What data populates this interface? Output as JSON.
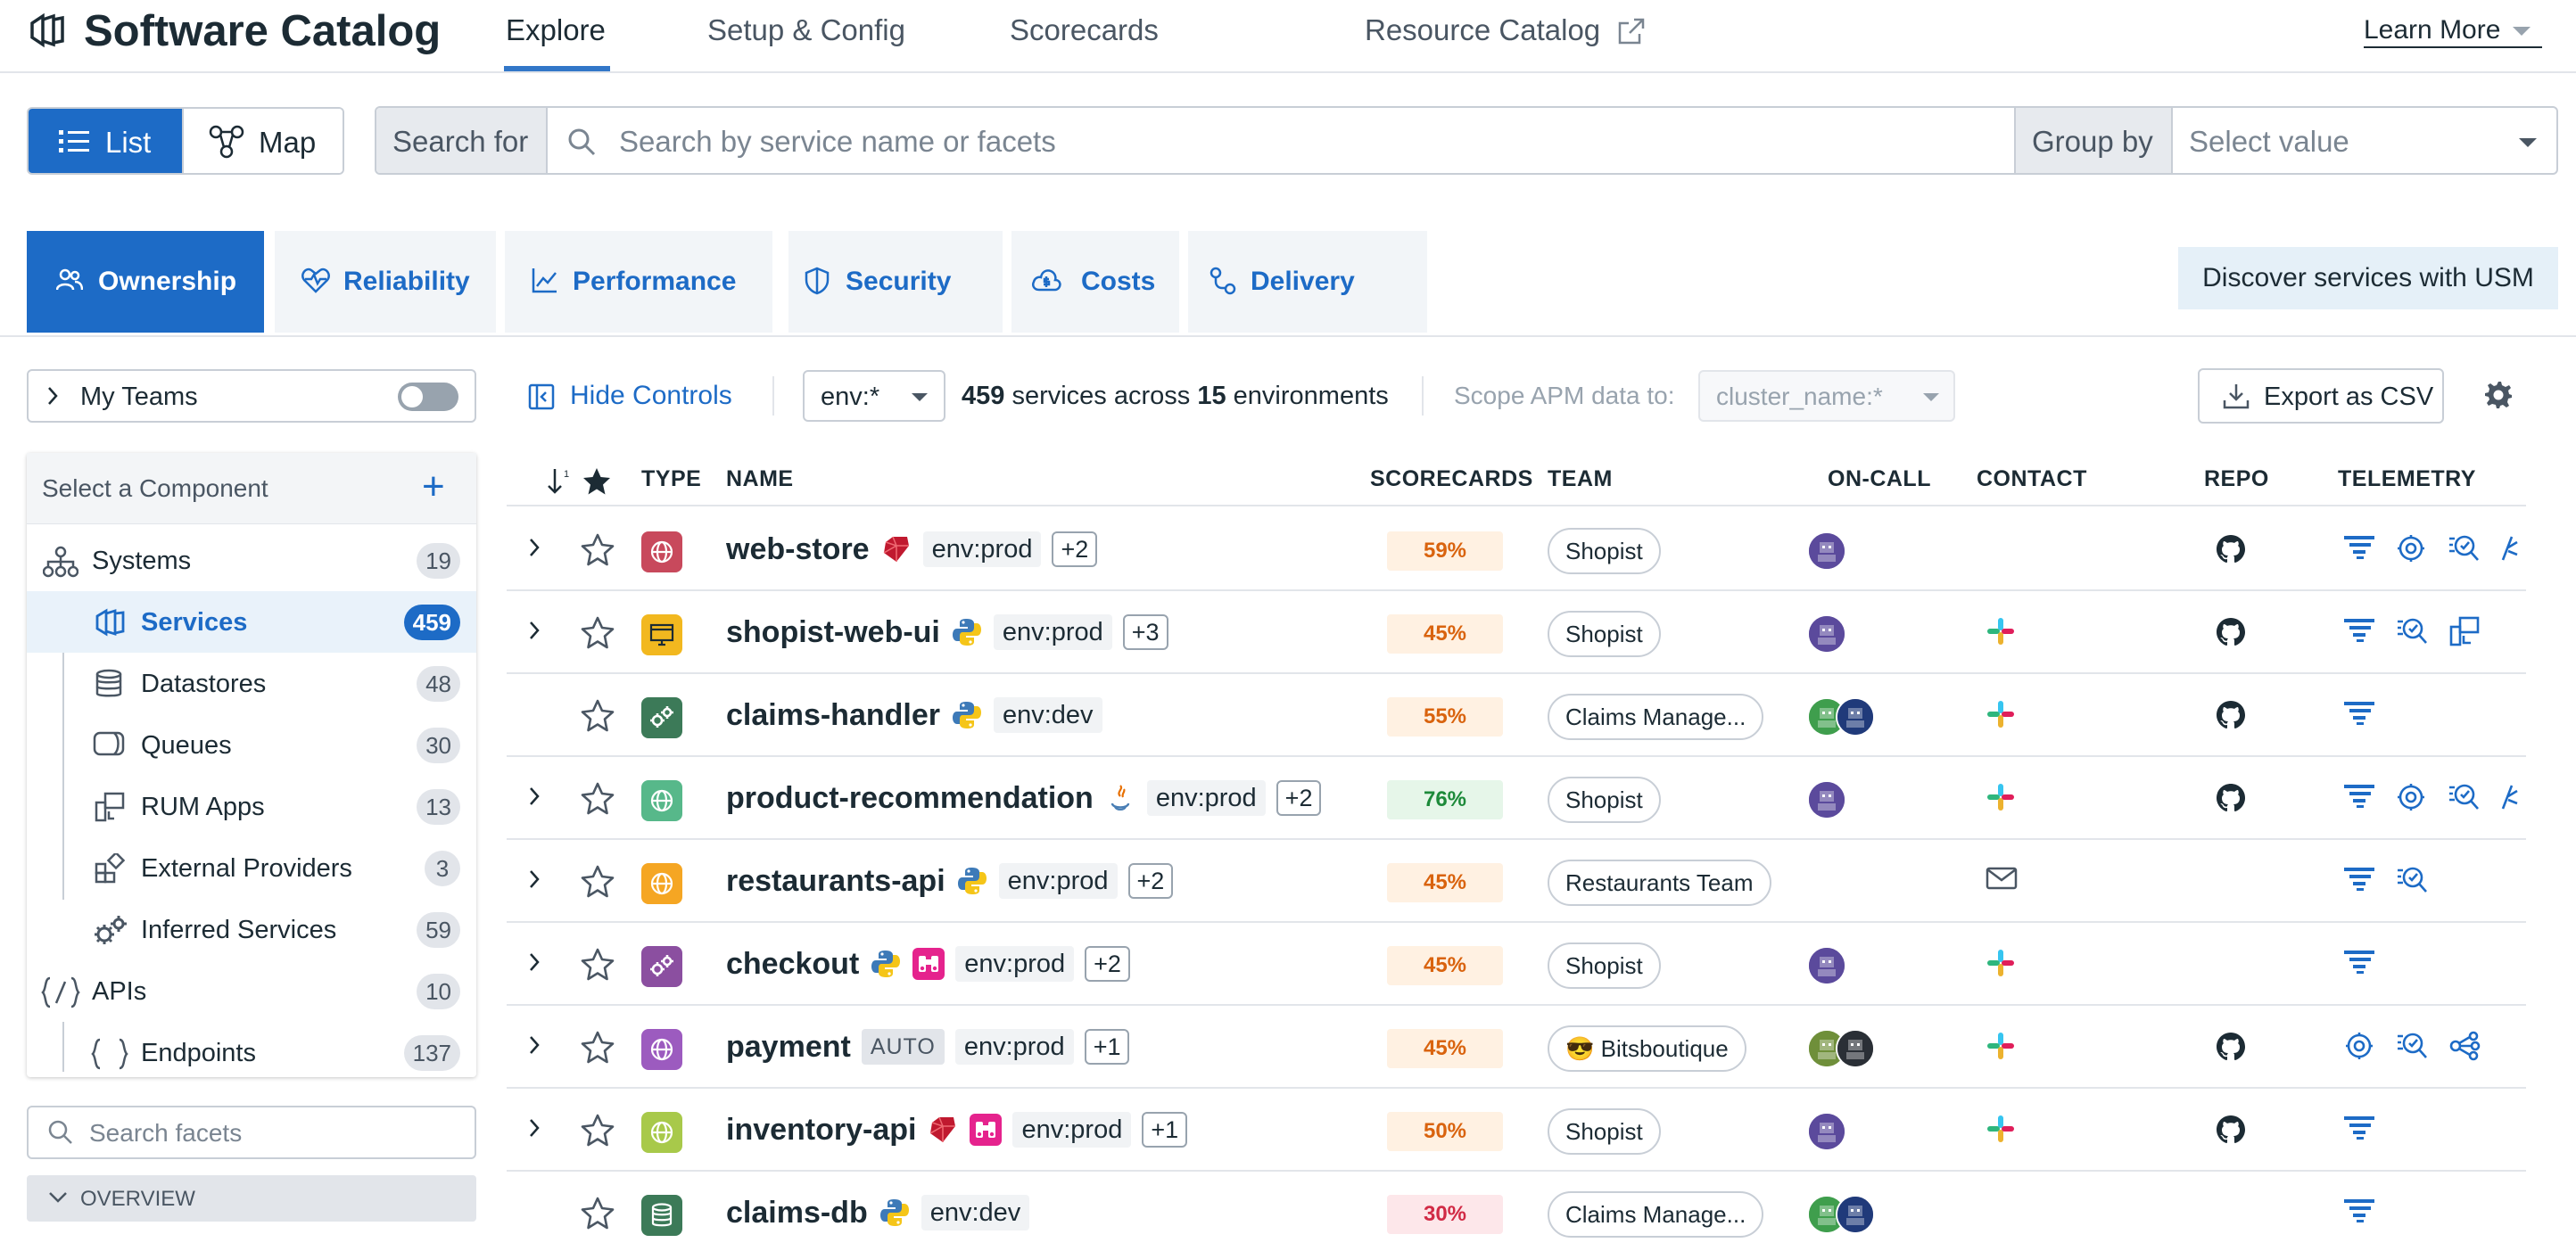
{
  "app": {
    "title": "Software Catalog"
  },
  "nav": {
    "tabs": [
      {
        "label": "Explore",
        "active": true
      },
      {
        "label": "Setup & Config"
      },
      {
        "label": "Scorecards"
      },
      {
        "label": "Resource Catalog",
        "icon": "external-link-icon"
      }
    ],
    "learn_more": "Learn More"
  },
  "toolbar": {
    "list_label": "List",
    "map_label": "Map",
    "search_for": "Search for",
    "search_placeholder": "Search by service name or facets",
    "group_by": "Group by",
    "group_placeholder": "Select value"
  },
  "categories": {
    "tabs": [
      {
        "label": "Ownership",
        "icon": "people-icon",
        "active": true
      },
      {
        "label": "Reliability",
        "icon": "heartbeat-icon"
      },
      {
        "label": "Performance",
        "icon": "trend-chart-icon"
      },
      {
        "label": "Security",
        "icon": "shield-icon"
      },
      {
        "label": "Costs",
        "icon": "cloud-dollar-icon"
      },
      {
        "label": "Delivery",
        "icon": "pipeline-icon"
      }
    ],
    "usm_button": "Discover services with USM"
  },
  "sidebar": {
    "my_teams": "My Teams",
    "my_teams_enabled": false,
    "component_title": "Select a Component",
    "items": [
      {
        "label": "Systems",
        "count": "19",
        "icon": "hierarchy-icon"
      },
      {
        "label": "Services",
        "count": "459",
        "icon": "services-icon",
        "selected": true
      },
      {
        "label": "Datastores",
        "count": "48",
        "icon": "database-icon"
      },
      {
        "label": "Queues",
        "count": "30",
        "icon": "queue-icon"
      },
      {
        "label": "RUM Apps",
        "count": "13",
        "icon": "rum-icon"
      },
      {
        "label": "External Providers",
        "count": "3",
        "icon": "external-provider-icon"
      },
      {
        "label": "Inferred Services",
        "count": "59",
        "icon": "gears-icon"
      },
      {
        "label": "APIs",
        "count": "10",
        "icon": "api-icon"
      },
      {
        "label": "Endpoints",
        "count": "137",
        "icon": "braces-icon"
      }
    ],
    "facet_placeholder": "Search facets",
    "overview": "OVERVIEW"
  },
  "controls": {
    "hide_controls": "Hide Controls",
    "env": "env:*",
    "service_count": "459",
    "services_text": "services across",
    "env_count": "15",
    "env_text": "environments",
    "scope_label": "Scope APM data to:",
    "scope_value": "cluster_name:*",
    "export": "Export as CSV"
  },
  "table": {
    "headers": {
      "type": "TYPE",
      "name": "NAME",
      "scorecards": "SCORECARDS",
      "team": "TEAM",
      "oncall": "ON-CALL",
      "contact": "CONTACT",
      "repo": "REPO",
      "telemetry": "TELEMETRY"
    },
    "rows": [
      {
        "name": "web-store",
        "type": "web",
        "type_color": "#c8495c",
        "lang": "ruby",
        "env": "env:prod",
        "more": "+2",
        "score": "59%",
        "score_level": "orange",
        "team": "Shopist",
        "oncall": [
          "purple"
        ],
        "contact": "",
        "repo": true,
        "telemetry": [
          "traces",
          "profiler",
          "rum-search",
          "code"
        ],
        "expandable": true
      },
      {
        "name": "shopist-web-ui",
        "type": "browser",
        "type_color": "#f2b81f",
        "lang": "python",
        "env": "env:prod",
        "more": "+3",
        "score": "45%",
        "score_level": "orange",
        "team": "Shopist",
        "oncall": [
          "purple"
        ],
        "contact": "slack",
        "repo": true,
        "telemetry": [
          "traces",
          "rum-search",
          "session"
        ],
        "expandable": true
      },
      {
        "name": "claims-handler",
        "type": "custom",
        "type_color": "#3c7a58",
        "lang": "python",
        "env": "env:dev",
        "more": "",
        "score": "55%",
        "score_level": "orange",
        "team": "Claims Manage...",
        "oncall": [
          "green",
          "navy"
        ],
        "contact": "slack",
        "repo": true,
        "telemetry": [
          "traces"
        ],
        "expandable": false
      },
      {
        "name": "product-recommendation",
        "type": "web",
        "type_color": "#57b88a",
        "lang": "java",
        "env": "env:prod",
        "more": "+2",
        "score": "76%",
        "score_level": "green",
        "team": "Shopist",
        "oncall": [
          "purple"
        ],
        "contact": "slack",
        "repo": true,
        "telemetry": [
          "traces",
          "profiler",
          "rum-search",
          "code"
        ],
        "expandable": true
      },
      {
        "name": "restaurants-api",
        "type": "web",
        "type_color": "#f5a623",
        "lang": "python",
        "env": "env:prod",
        "more": "+2",
        "score": "45%",
        "score_level": "orange",
        "team": "Restaurants Team",
        "oncall": [],
        "contact": "email",
        "repo": false,
        "telemetry": [
          "traces",
          "rum-search"
        ],
        "expandable": true
      },
      {
        "name": "checkout",
        "type": "custom",
        "type_color": "#8b4fa0",
        "lang": "python",
        "lang2": "binoculars",
        "env": "env:prod",
        "more": "+2",
        "score": "45%",
        "score_level": "orange",
        "team": "Shopist",
        "oncall": [
          "purple"
        ],
        "contact": "slack",
        "repo": false,
        "telemetry": [
          "traces"
        ],
        "expandable": true
      },
      {
        "name": "payment",
        "type": "web",
        "type_color": "#9c5bbf",
        "badge": "AUTO",
        "env": "env:prod",
        "more": "+1",
        "score": "45%",
        "score_level": "orange",
        "team": "😎 Bitsboutique",
        "oncall": [
          "olive",
          "dark"
        ],
        "contact": "slack",
        "repo": true,
        "telemetry": [
          "profiler",
          "rum-search",
          "service-map"
        ],
        "expandable": true
      },
      {
        "name": "inventory-api",
        "type": "web",
        "type_color": "#a8c94a",
        "lang": "ruby",
        "lang2": "binoculars",
        "env": "env:prod",
        "more": "+1",
        "score": "50%",
        "score_level": "orange",
        "team": "Shopist",
        "oncall": [
          "purple"
        ],
        "contact": "slack",
        "repo": true,
        "telemetry": [
          "traces"
        ],
        "expandable": true
      },
      {
        "name": "claims-db",
        "type": "database",
        "type_color": "#3c7a58",
        "lang": "python",
        "env": "env:dev",
        "more": "",
        "score": "30%",
        "score_level": "red",
        "team": "Claims Manage...",
        "oncall": [
          "green",
          "navy"
        ],
        "contact": "",
        "repo": false,
        "telemetry": [
          "traces"
        ],
        "expandable": false
      }
    ]
  },
  "colors": {
    "accent": "#1d6bc6",
    "border": "#c8ced6",
    "brand_dark": "#1c2b34"
  }
}
